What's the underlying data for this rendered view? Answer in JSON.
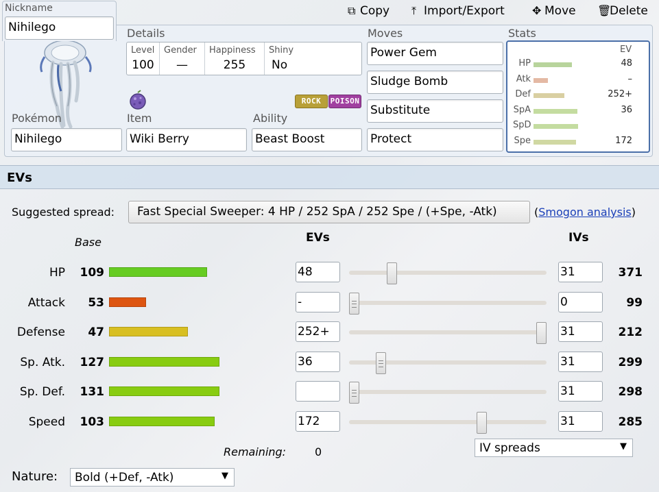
{
  "actions": {
    "copy": "Copy",
    "import_export": "Import/Export",
    "move": "Move",
    "delete": "Delete"
  },
  "nickname": {
    "label": "Nickname",
    "value": "Nihilego"
  },
  "details": {
    "label": "Details",
    "level_label": "Level",
    "level": "100",
    "gender_label": "Gender",
    "gender": "—",
    "happiness_label": "Happiness",
    "happiness": "255",
    "shiny_label": "Shiny",
    "shiny": "No"
  },
  "types": [
    {
      "name": "ROCK",
      "color": "#b8a038"
    },
    {
      "name": "POISON",
      "color": "#a040a0"
    }
  ],
  "pokemon": {
    "label": "Pokémon",
    "value": "Nihilego"
  },
  "item": {
    "label": "Item",
    "value": "Wiki Berry"
  },
  "ability": {
    "label": "Ability",
    "value": "Beast Boost"
  },
  "moves": {
    "label": "Moves",
    "list": [
      "Power Gem",
      "Sludge Bomb",
      "Substitute",
      "Protect"
    ]
  },
  "stats_summary": {
    "label": "Stats",
    "ev_header": "EV",
    "rows": [
      {
        "name": "HP",
        "ev": "48",
        "bar_fraction": 0.56,
        "color": "#b8d49c"
      },
      {
        "name": "Atk",
        "ev": "–",
        "bar_fraction": 0.21,
        "color": "#e4b9a4"
      },
      {
        "name": "Def",
        "ev": "252+",
        "bar_fraction": 0.45,
        "color": "#d9cfa2"
      },
      {
        "name": "SpA",
        "ev": "36",
        "bar_fraction": 0.64,
        "color": "#c4dca0"
      },
      {
        "name": "SpD",
        "ev": "",
        "bar_fraction": 0.65,
        "color": "#c4dca0"
      },
      {
        "name": "Spe",
        "ev": "172",
        "bar_fraction": 0.62,
        "color": "#d0d8a2"
      }
    ]
  },
  "evs_section": {
    "title": "EVs",
    "suggested_label": "Suggested spread:",
    "suggested_value": "Fast Special Sweeper: 4 HP / 252 SpA / 252 Spe / (+Spe, -Atk)",
    "smogon_open": "(",
    "smogon_link": "Smogon analysis",
    "smogon_close": ")",
    "base_header": "Base",
    "evs_header": "EVs",
    "ivs_header": "IVs",
    "rows": [
      {
        "name": "HP",
        "base": "109",
        "base_fraction": 0.56,
        "base_color": "#66cc22",
        "ev": "48",
        "ev_fraction": 0.203,
        "iv": "31",
        "total": "371"
      },
      {
        "name": "Attack",
        "base": "53",
        "base_fraction": 0.21,
        "base_color": "#dd5511",
        "ev": "-",
        "ev_fraction": 0.0,
        "iv": "0",
        "total": "99"
      },
      {
        "name": "Defense",
        "base": "47",
        "base_fraction": 0.45,
        "base_color": "#d8bf22",
        "ev": "252+",
        "ev_fraction": 1.0,
        "iv": "31",
        "total": "212"
      },
      {
        "name": "Sp. Atk.",
        "base": "127",
        "base_fraction": 0.63,
        "base_color": "#88cc11",
        "ev": "36",
        "ev_fraction": 0.143,
        "iv": "31",
        "total": "299"
      },
      {
        "name": "Sp. Def.",
        "base": "131",
        "base_fraction": 0.63,
        "base_color": "#88cc11",
        "ev": "",
        "ev_fraction": 0.0,
        "iv": "31",
        "total": "298"
      },
      {
        "name": "Speed",
        "base": "103",
        "base_fraction": 0.6,
        "base_color": "#88cc11",
        "ev": "172",
        "ev_fraction": 0.682,
        "iv": "31",
        "total": "285"
      }
    ],
    "remaining_label": "Remaining:",
    "remaining_value": "0",
    "iv_spreads": "IV spreads",
    "nature_label": "Nature:",
    "nature_value": "Bold (+Def, -Atk)"
  }
}
